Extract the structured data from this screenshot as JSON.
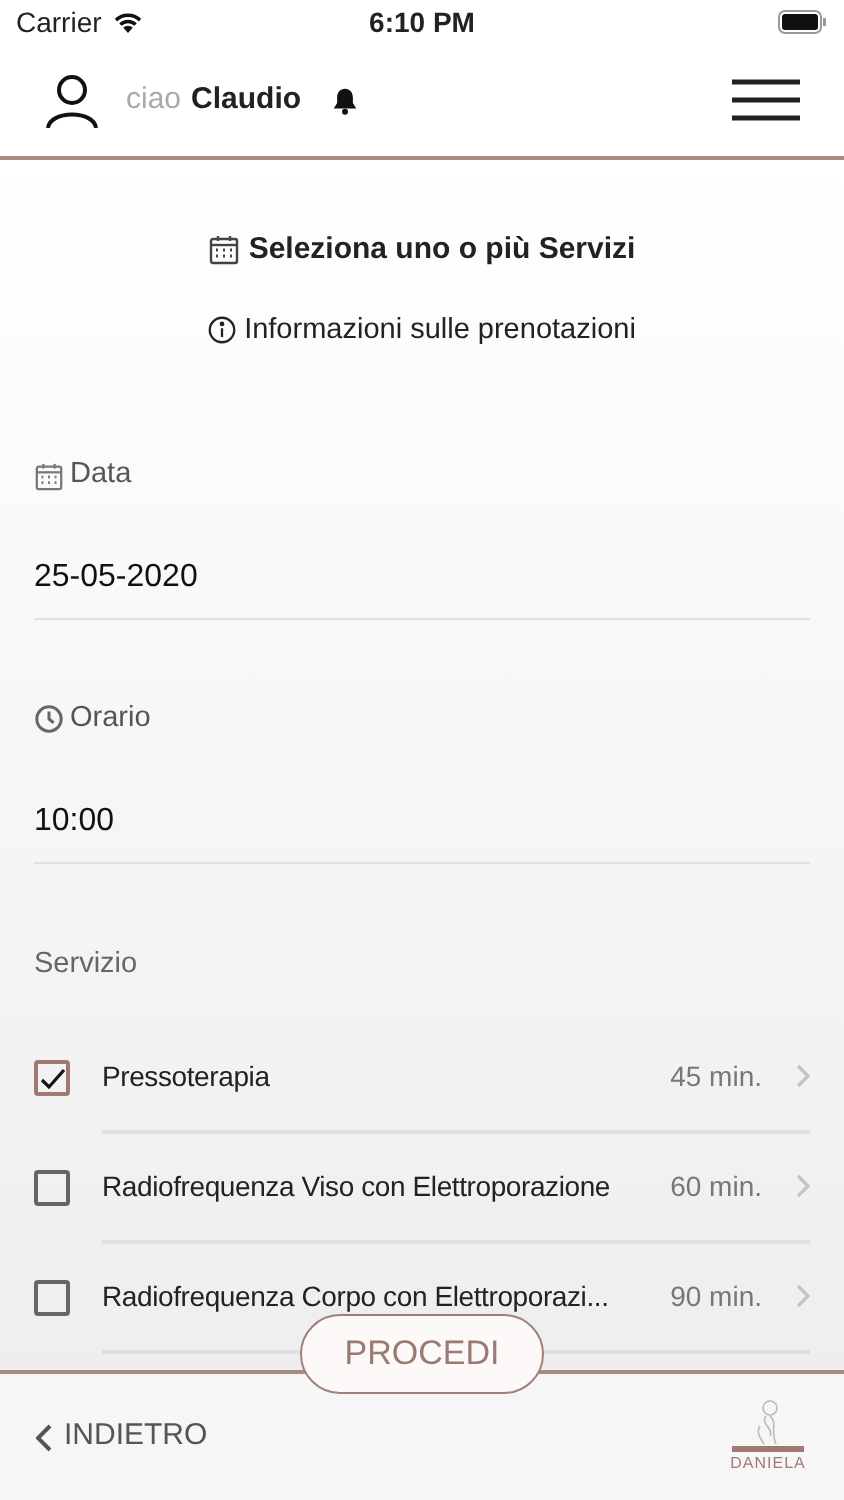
{
  "status_bar": {
    "carrier": "Carrier",
    "time": "6:10 PM"
  },
  "header": {
    "greeting": "ciao",
    "user": "Claudio"
  },
  "title": "Seleziona uno o più Servizi",
  "info_link": "Informazioni sulle prenotazioni",
  "fields": [
    {
      "kind": "date",
      "label": "Data",
      "value": "25-05-2020"
    },
    {
      "kind": "time",
      "label": "Orario",
      "value": "10:00"
    }
  ],
  "services_label": "Servizio",
  "services": [
    {
      "name": "Pressoterapia",
      "duration": "45 min.",
      "checked": true
    },
    {
      "name": "Radiofrequenza Viso con Elettroporazione",
      "duration": "60 min.",
      "checked": false
    },
    {
      "name": "Radiofrequenza Corpo con Elettroporazi...",
      "duration": "90 min.",
      "checked": false
    }
  ],
  "proceed_button": "PROCEDI",
  "footer": {
    "back": "INDIETRO",
    "logo_text": "DANIELA"
  }
}
